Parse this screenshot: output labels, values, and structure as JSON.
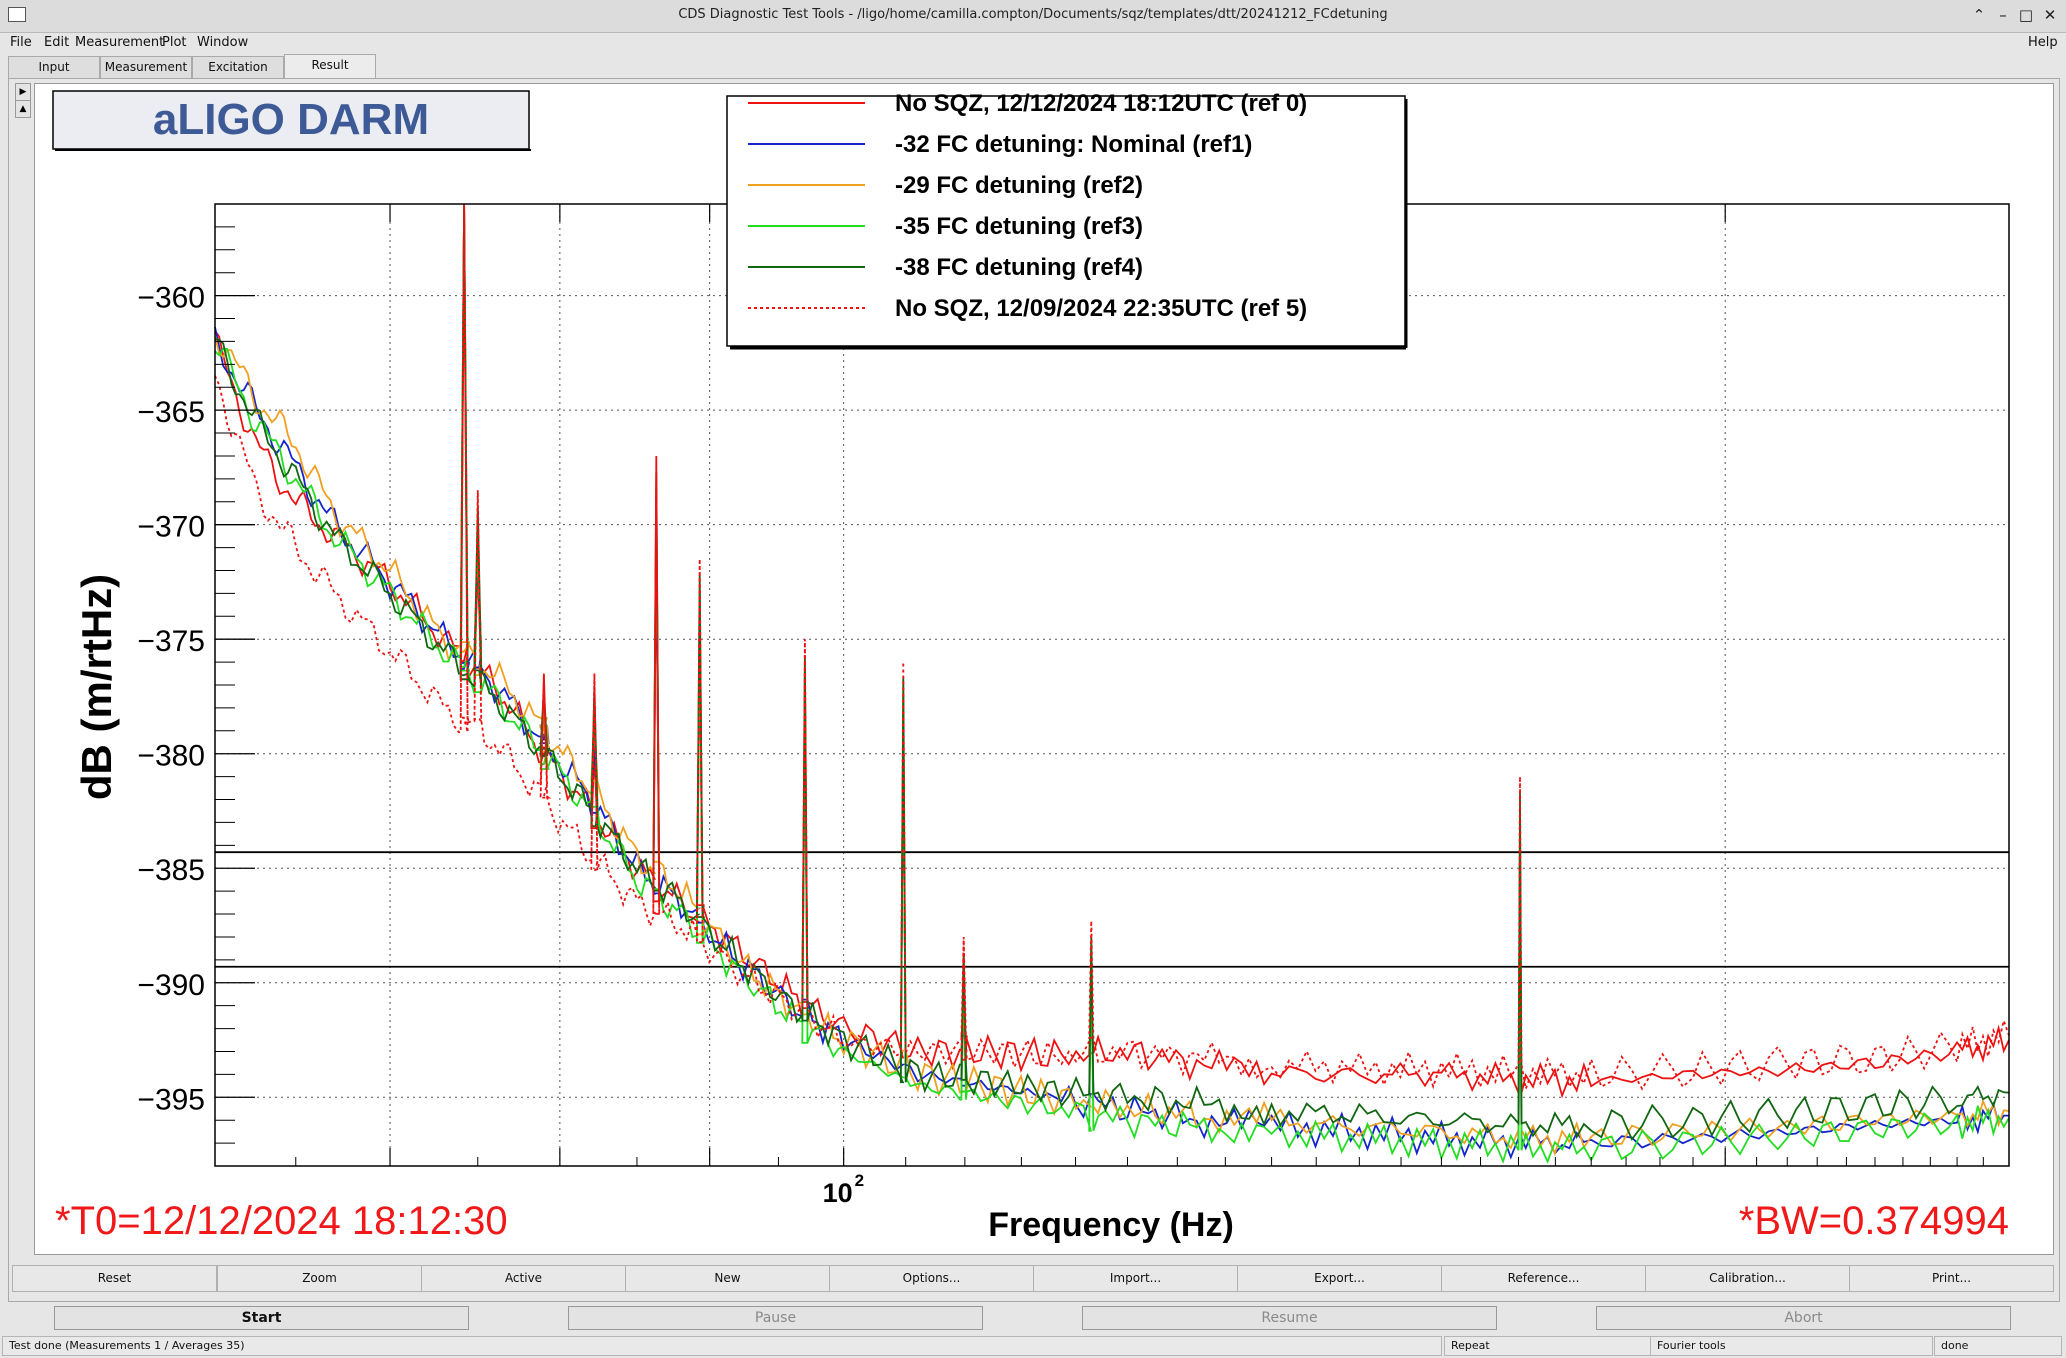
{
  "window": {
    "title": "CDS Diagnostic Test Tools - /ligo/home/camilla.compton/Documents/sqz/templates/dtt/20241212_FCdetuning"
  },
  "menu": {
    "file": "File",
    "edit": "Edit",
    "measurement": "Measurement",
    "plot": "Plot",
    "window": "Window",
    "help": "Help"
  },
  "tabs": [
    "Input",
    "Measurement",
    "Excitation",
    "Result"
  ],
  "plot": {
    "title_box": "aLIGO DARM",
    "ylabel": "dB (m/rtHz)",
    "xlabel": "Frequency (Hz)",
    "x_tick_base": "10",
    "x_tick_exp": "2",
    "t0_label": "*T0=12/12/2024 18:12:30",
    "bw_label": "*BW=0.374994",
    "y_ticks": [
      "−360",
      "−365",
      "−370",
      "−375",
      "−380",
      "−385",
      "−390",
      "−395"
    ]
  },
  "chart_data": {
    "type": "line",
    "title": "aLIGO DARM",
    "xlabel": "Frequency (Hz)",
    "ylabel": "dB (m/rtHz)",
    "xscale": "log",
    "xlim": [
      61,
      250
    ],
    "ylim": [
      -398,
      -356
    ],
    "grid": true,
    "legend_position": "top-center",
    "hlines": [
      -384.3,
      -389.3
    ],
    "series": [
      {
        "name": "No SQZ, 12/12/2024  18:12UTC (ref 0)",
        "color": "#ee1111",
        "dash": "solid",
        "x": [
          61,
          63,
          65,
          67,
          70,
          73,
          76,
          79,
          82,
          85,
          88,
          92,
          96,
          100,
          106,
          112,
          118,
          125,
          132,
          140,
          150,
          160,
          170,
          180,
          195,
          210,
          225,
          240,
          250
        ],
        "y": [
          -362,
          -366.5,
          -369,
          -370.5,
          -372.5,
          -375,
          -377,
          -380,
          -382.5,
          -385,
          -386.5,
          -388.5,
          -390.5,
          -392,
          -393,
          -393,
          -393.2,
          -393,
          -393.5,
          -394,
          -394,
          -394,
          -394.2,
          -394.3,
          -394,
          -393.8,
          -393.5,
          -393,
          -392.5
        ]
      },
      {
        "name": "-32 FC detuning: Nominal (ref1)",
        "color": "#1525cc",
        "dash": "solid",
        "x": [
          61,
          63,
          65,
          67,
          70,
          73,
          76,
          79,
          82,
          85,
          88,
          92,
          96,
          100,
          106,
          112,
          118,
          125,
          132,
          140,
          150,
          160,
          170,
          180,
          195,
          210,
          225,
          240,
          250
        ],
        "y": [
          -362,
          -365,
          -367.5,
          -370,
          -372.5,
          -375,
          -377,
          -379.5,
          -382,
          -385,
          -386.5,
          -389,
          -391,
          -392.5,
          -394,
          -394.5,
          -395,
          -395.5,
          -396,
          -396.3,
          -396.5,
          -396.8,
          -397,
          -397,
          -396.8,
          -396.5,
          -396.2,
          -396,
          -395.8
        ]
      },
      {
        "name": "-29 FC detuning (ref2)",
        "color": "#f0a020",
        "dash": "solid",
        "x": [
          61,
          63,
          65,
          67,
          70,
          73,
          76,
          79,
          82,
          85,
          88,
          92,
          96,
          100,
          106,
          112,
          118,
          125,
          132,
          140,
          150,
          160,
          170,
          180,
          195,
          210,
          225,
          240,
          250
        ],
        "y": [
          -361.5,
          -364.5,
          -366.5,
          -369.5,
          -372,
          -375,
          -376.5,
          -379,
          -381.5,
          -384.5,
          -386,
          -389,
          -391,
          -392.5,
          -394,
          -394.5,
          -395,
          -395.5,
          -395.8,
          -396,
          -396.3,
          -396.5,
          -396.8,
          -396.8,
          -396.5,
          -396.3,
          -396,
          -395.8,
          -395.6
        ]
      },
      {
        "name": "-35 FC detuning (ref3)",
        "color": "#22dd22",
        "dash": "solid",
        "x": [
          61,
          63,
          65,
          67,
          70,
          73,
          76,
          79,
          82,
          85,
          88,
          92,
          96,
          100,
          106,
          112,
          118,
          125,
          132,
          140,
          150,
          160,
          170,
          180,
          195,
          210,
          225,
          240,
          250
        ],
        "y": [
          -362,
          -365.5,
          -368,
          -370.5,
          -373,
          -375.5,
          -377.5,
          -380,
          -382.5,
          -385.5,
          -387,
          -389.5,
          -391.5,
          -393,
          -394.5,
          -395,
          -395.5,
          -396,
          -396.3,
          -396.5,
          -396.8,
          -397,
          -397.2,
          -397.2,
          -397,
          -396.7,
          -396.4,
          -396.1,
          -395.9
        ]
      },
      {
        "name": "-38 FC detuning (ref4)",
        "color": "#116611",
        "dash": "solid",
        "x": [
          61,
          63,
          65,
          67,
          70,
          73,
          76,
          79,
          82,
          85,
          88,
          92,
          96,
          100,
          106,
          112,
          118,
          125,
          132,
          140,
          150,
          160,
          170,
          180,
          195,
          210,
          225,
          240,
          250
        ],
        "y": [
          -362,
          -365.5,
          -368,
          -370.5,
          -373,
          -375.5,
          -377.5,
          -380,
          -382.5,
          -385,
          -386.5,
          -389,
          -391,
          -392.5,
          -394,
          -394.3,
          -394.7,
          -395,
          -395.3,
          -395.6,
          -395.8,
          -396,
          -396.2,
          -396.2,
          -396,
          -395.7,
          -395.4,
          -395.1,
          -394.8
        ]
      },
      {
        "name": "No SQZ, 12/09/2024 22:35UTC (ref 5)",
        "color": "#ee1111",
        "dash": "dotted",
        "x": [
          61,
          63,
          65,
          67,
          70,
          73,
          76,
          79,
          82,
          85,
          88,
          92,
          96,
          100,
          106,
          112,
          118,
          125,
          132,
          140,
          150,
          160,
          170,
          180,
          195,
          210,
          225,
          240,
          250
        ],
        "y": [
          -363.5,
          -368.5,
          -371,
          -373,
          -375.5,
          -378,
          -379.5,
          -382,
          -384.5,
          -386.5,
          -387.5,
          -389.5,
          -391,
          -392.5,
          -393,
          -393,
          -393.2,
          -393,
          -393.3,
          -393.6,
          -393.7,
          -393.8,
          -393.9,
          -394,
          -393.8,
          -393.5,
          -393.3,
          -392.8,
          -392.3
        ]
      }
    ]
  },
  "toolbar": [
    "Reset",
    "Zoom",
    "Active",
    "New",
    "Options...",
    "Import...",
    "Export...",
    "Reference...",
    "Calibration...",
    "Print..."
  ],
  "run": {
    "start": "Start",
    "pause": "Pause",
    "resume": "Resume",
    "abort": "Abort"
  },
  "status": {
    "message": "Test done (Measurements 1 / Averages 35)",
    "repeat": "Repeat",
    "tools": "Fourier tools",
    "state": "done"
  }
}
